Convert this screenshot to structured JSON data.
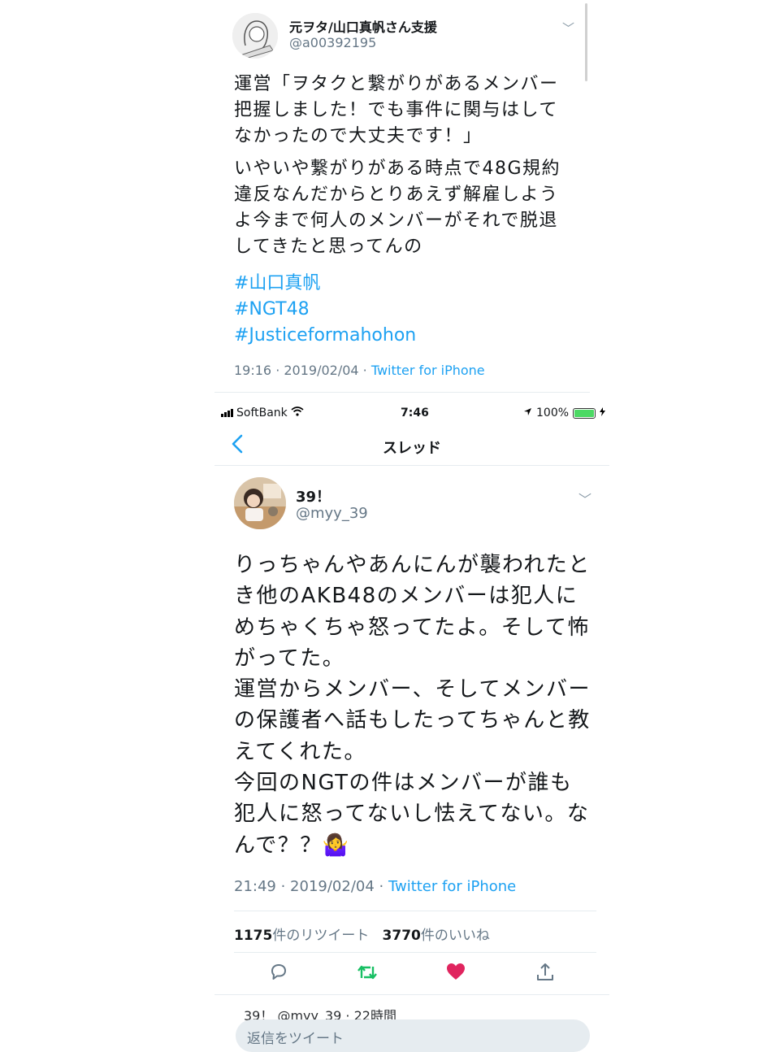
{
  "tweet_top": {
    "name": "元ヲタ/山口真帆さん支援",
    "handle": "@a00392195",
    "paragraphs": [
      "運営「ヲタクと繋がりがあるメンバー把握しました！でも事件に関与はしてなかったので大丈夫です！」",
      "いやいや繋がりがある時点で48G規約違反なんだからとりあえず解雇しようよ今まで何人のメンバーがそれで脱退してきたと思ってんの"
    ],
    "hashtags": [
      "#山口真帆",
      "#NGT48",
      "#Justiceformahohon"
    ],
    "time": "19:16 · 2019/02/04 · ",
    "source": "Twitter for iPhone"
  },
  "status_bar": {
    "carrier": "SoftBank",
    "time": "7:46",
    "battery": "100%"
  },
  "nav": {
    "title": "スレッド"
  },
  "tweet_main": {
    "name": "39！",
    "handle": "@myy_39",
    "body": "りっちゃんやあんにんが襲われたとき他のAKB48のメンバーは犯人にめちゃくちゃ怒ってたよ。そして怖がってた。\n運営からメンバー、そしてメンバーの保護者へ話もしたってちゃんと教えてくれた。\n今回のNGTの件はメンバーが誰も犯人に怒ってないし怯えてない。なんで？？🤷‍♀️",
    "time": "21:49 · 2019/02/04 · ",
    "source": "Twitter for iPhone",
    "retweet_count": "1175",
    "retweet_label": "件のリツイート",
    "like_count": "3770",
    "like_label": "件のいいね"
  },
  "reply_placeholder": "返信をツイート",
  "partial_next": "39！ @myy_39 · 22時間",
  "colors": {
    "link": "#1da1f2",
    "retweet": "#17bf63",
    "like": "#e0245e",
    "muted": "#657786"
  }
}
